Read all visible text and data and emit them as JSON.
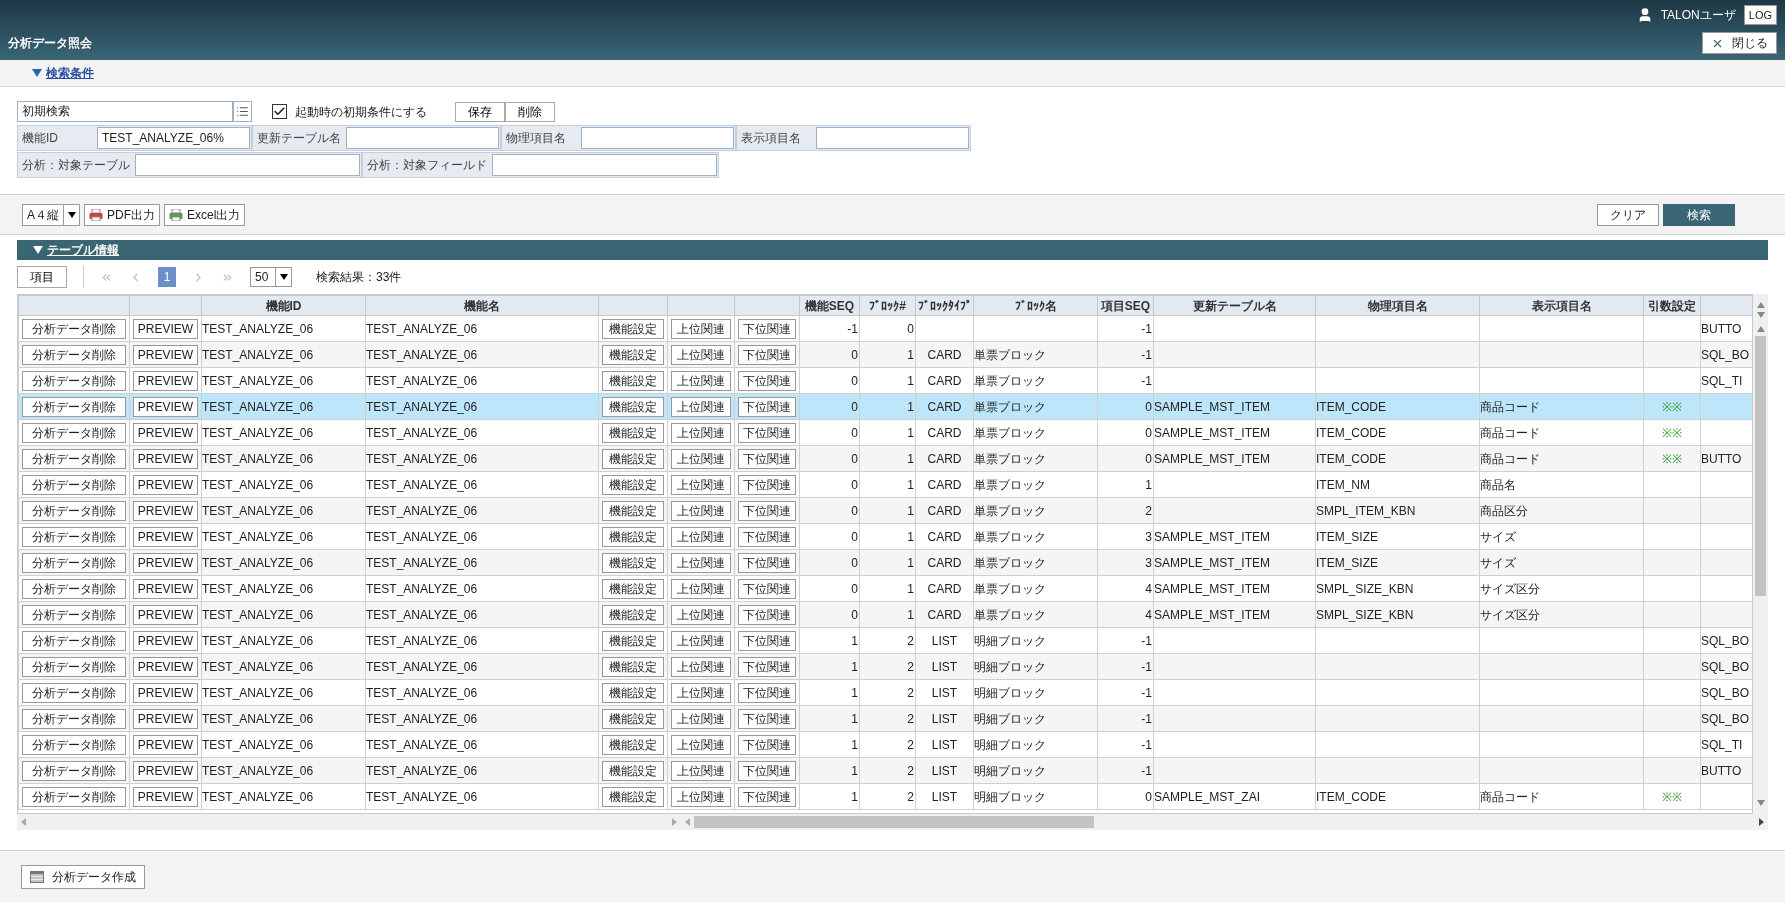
{
  "header": {
    "user": "TALONユーザ",
    "log_button": "LOG",
    "title": "分析データ照会",
    "close_button": "閉じる"
  },
  "search_section": {
    "title": "検索条件",
    "expanded": true,
    "preset": {
      "value": "初期検索"
    },
    "default_checkbox": {
      "label": "起動時の初期条件にする",
      "checked": true
    },
    "buttons": [
      "保存",
      "削除"
    ],
    "field_rows": [
      [
        {
          "label": "機能ID",
          "value": "TEST_ANALYZE_06%"
        },
        {
          "label": "更新テーブル名"
        },
        {
          "label": "物理項目名"
        },
        {
          "label": "表示項目名"
        }
      ],
      [
        {
          "label": "分析：対象テーブル"
        },
        {
          "label": "分析：対象フィールド"
        }
      ]
    ]
  },
  "toolbar": {
    "paper_size": "A４縦",
    "buttons": [
      {
        "kind": "pdf",
        "label": "PDF出力"
      },
      {
        "kind": "excel",
        "label": "Excel出力"
      }
    ],
    "clear_button": "クリア",
    "search_button": "検索"
  },
  "table_section": {
    "title": "テーブル情報",
    "expanded": true,
    "columns_button": "項目",
    "pager": {
      "pages": [
        {
          "label": "1",
          "selected": true
        }
      ],
      "page_size": "50",
      "result": "検索結果：33件"
    },
    "columns": [
      {
        "kind": "button"
      },
      {
        "kind": "button"
      },
      {
        "kind": "text",
        "label": "機能ID"
      },
      {
        "kind": "text",
        "label": "機能名"
      },
      {
        "kind": "button"
      },
      {
        "kind": "button"
      },
      {
        "kind": "button"
      },
      {
        "kind": "number",
        "label": "機能SEQ"
      },
      {
        "kind": "number",
        "label": "ﾌﾞﾛｯｸ#"
      },
      {
        "kind": "center",
        "label": "ﾌﾞﾛｯｸﾀｲﾌﾟ"
      },
      {
        "kind": "text",
        "label": "ﾌﾞﾛｯｸ名"
      },
      {
        "kind": "number",
        "label": "項目SEQ"
      },
      {
        "kind": "text",
        "label": "更新テーブル名"
      },
      {
        "kind": "text",
        "label": "物理項目名"
      },
      {
        "kind": "text",
        "label": "表示項目名"
      },
      {
        "kind": "mark",
        "label": "引数設定"
      },
      {
        "kind": "text"
      }
    ],
    "rows": [
      {
        "selected": false,
        "cells": [
          "分析データ削除",
          "PREVIEW",
          "TEST_ANALYZE_06",
          "TEST_ANALYZE_06",
          "機能設定",
          "上位関連",
          "下位関連",
          "-1",
          "0",
          null,
          null,
          "-1",
          null,
          null,
          null,
          null,
          "BUTTO"
        ]
      },
      {
        "selected": false,
        "cells": [
          "分析データ削除",
          "PREVIEW",
          "TEST_ANALYZE_06",
          "TEST_ANALYZE_06",
          "機能設定",
          "上位関連",
          "下位関連",
          "0",
          "1",
          "CARD",
          "単票ブロック",
          "-1",
          null,
          null,
          null,
          null,
          "SQL_BO"
        ]
      },
      {
        "selected": false,
        "cells": [
          "分析データ削除",
          "PREVIEW",
          "TEST_ANALYZE_06",
          "TEST_ANALYZE_06",
          "機能設定",
          "上位関連",
          "下位関連",
          "0",
          "1",
          "CARD",
          "単票ブロック",
          "-1",
          null,
          null,
          null,
          null,
          "SQL_TI"
        ]
      },
      {
        "selected": true,
        "cells": [
          "分析データ削除",
          "PREVIEW",
          "TEST_ANALYZE_06",
          "TEST_ANALYZE_06",
          "機能設定",
          "上位関連",
          "下位関連",
          "0",
          "1",
          "CARD",
          "単票ブロック",
          "0",
          "SAMPLE_MST_ITEM",
          "ITEM_CODE",
          "商品コード",
          "※※",
          null
        ]
      },
      {
        "selected": false,
        "cells": [
          "分析データ削除",
          "PREVIEW",
          "TEST_ANALYZE_06",
          "TEST_ANALYZE_06",
          "機能設定",
          "上位関連",
          "下位関連",
          "0",
          "1",
          "CARD",
          "単票ブロック",
          "0",
          "SAMPLE_MST_ITEM",
          "ITEM_CODE",
          "商品コード",
          "※※",
          null
        ]
      },
      {
        "selected": false,
        "cells": [
          "分析データ削除",
          "PREVIEW",
          "TEST_ANALYZE_06",
          "TEST_ANALYZE_06",
          "機能設定",
          "上位関連",
          "下位関連",
          "0",
          "1",
          "CARD",
          "単票ブロック",
          "0",
          "SAMPLE_MST_ITEM",
          "ITEM_CODE",
          "商品コード",
          "※※",
          "BUTTO"
        ]
      },
      {
        "selected": false,
        "cells": [
          "分析データ削除",
          "PREVIEW",
          "TEST_ANALYZE_06",
          "TEST_ANALYZE_06",
          "機能設定",
          "上位関連",
          "下位関連",
          "0",
          "1",
          "CARD",
          "単票ブロック",
          "1",
          null,
          "ITEM_NM",
          "商品名",
          null,
          null
        ]
      },
      {
        "selected": false,
        "cells": [
          "分析データ削除",
          "PREVIEW",
          "TEST_ANALYZE_06",
          "TEST_ANALYZE_06",
          "機能設定",
          "上位関連",
          "下位関連",
          "0",
          "1",
          "CARD",
          "単票ブロック",
          "2",
          null,
          "SMPL_ITEM_KBN",
          "商品区分",
          null,
          null
        ]
      },
      {
        "selected": false,
        "cells": [
          "分析データ削除",
          "PREVIEW",
          "TEST_ANALYZE_06",
          "TEST_ANALYZE_06",
          "機能設定",
          "上位関連",
          "下位関連",
          "0",
          "1",
          "CARD",
          "単票ブロック",
          "3",
          "SAMPLE_MST_ITEM",
          "ITEM_SIZE",
          "サイズ",
          null,
          null
        ]
      },
      {
        "selected": false,
        "cells": [
          "分析データ削除",
          "PREVIEW",
          "TEST_ANALYZE_06",
          "TEST_ANALYZE_06",
          "機能設定",
          "上位関連",
          "下位関連",
          "0",
          "1",
          "CARD",
          "単票ブロック",
          "3",
          "SAMPLE_MST_ITEM",
          "ITEM_SIZE",
          "サイズ",
          null,
          null
        ]
      },
      {
        "selected": false,
        "cells": [
          "分析データ削除",
          "PREVIEW",
          "TEST_ANALYZE_06",
          "TEST_ANALYZE_06",
          "機能設定",
          "上位関連",
          "下位関連",
          "0",
          "1",
          "CARD",
          "単票ブロック",
          "4",
          "SAMPLE_MST_ITEM",
          "SMPL_SIZE_KBN",
          "サイズ区分",
          null,
          null
        ]
      },
      {
        "selected": false,
        "cells": [
          "分析データ削除",
          "PREVIEW",
          "TEST_ANALYZE_06",
          "TEST_ANALYZE_06",
          "機能設定",
          "上位関連",
          "下位関連",
          "0",
          "1",
          "CARD",
          "単票ブロック",
          "4",
          "SAMPLE_MST_ITEM",
          "SMPL_SIZE_KBN",
          "サイズ区分",
          null,
          null
        ]
      },
      {
        "selected": false,
        "cells": [
          "分析データ削除",
          "PREVIEW",
          "TEST_ANALYZE_06",
          "TEST_ANALYZE_06",
          "機能設定",
          "上位関連",
          "下位関連",
          "1",
          "2",
          "LIST",
          "明細ブロック",
          "-1",
          null,
          null,
          null,
          null,
          "SQL_BO"
        ]
      },
      {
        "selected": false,
        "cells": [
          "分析データ削除",
          "PREVIEW",
          "TEST_ANALYZE_06",
          "TEST_ANALYZE_06",
          "機能設定",
          "上位関連",
          "下位関連",
          "1",
          "2",
          "LIST",
          "明細ブロック",
          "-1",
          null,
          null,
          null,
          null,
          "SQL_BO"
        ]
      },
      {
        "selected": false,
        "cells": [
          "分析データ削除",
          "PREVIEW",
          "TEST_ANALYZE_06",
          "TEST_ANALYZE_06",
          "機能設定",
          "上位関連",
          "下位関連",
          "1",
          "2",
          "LIST",
          "明細ブロック",
          "-1",
          null,
          null,
          null,
          null,
          "SQL_BO"
        ]
      },
      {
        "selected": false,
        "cells": [
          "分析データ削除",
          "PREVIEW",
          "TEST_ANALYZE_06",
          "TEST_ANALYZE_06",
          "機能設定",
          "上位関連",
          "下位関連",
          "1",
          "2",
          "LIST",
          "明細ブロック",
          "-1",
          null,
          null,
          null,
          null,
          "SQL_BO"
        ]
      },
      {
        "selected": false,
        "cells": [
          "分析データ削除",
          "PREVIEW",
          "TEST_ANALYZE_06",
          "TEST_ANALYZE_06",
          "機能設定",
          "上位関連",
          "下位関連",
          "1",
          "2",
          "LIST",
          "明細ブロック",
          "-1",
          null,
          null,
          null,
          null,
          "SQL_TI"
        ]
      },
      {
        "selected": false,
        "cells": [
          "分析データ削除",
          "PREVIEW",
          "TEST_ANALYZE_06",
          "TEST_ANALYZE_06",
          "機能設定",
          "上位関連",
          "下位関連",
          "1",
          "2",
          "LIST",
          "明細ブロック",
          "-1",
          null,
          null,
          null,
          null,
          "BUTTO"
        ]
      },
      {
        "selected": false,
        "cells": [
          "分析データ削除",
          "PREVIEW",
          "TEST_ANALYZE_06",
          "TEST_ANALYZE_06",
          "機能設定",
          "上位関連",
          "下位関連",
          "1",
          "2",
          "LIST",
          "明細ブロック",
          "0",
          "SAMPLE_MST_ZAI",
          "ITEM_CODE",
          "商品コード",
          "※※",
          null
        ]
      }
    ]
  },
  "footer": {
    "create_button": "分析データ作成"
  }
}
